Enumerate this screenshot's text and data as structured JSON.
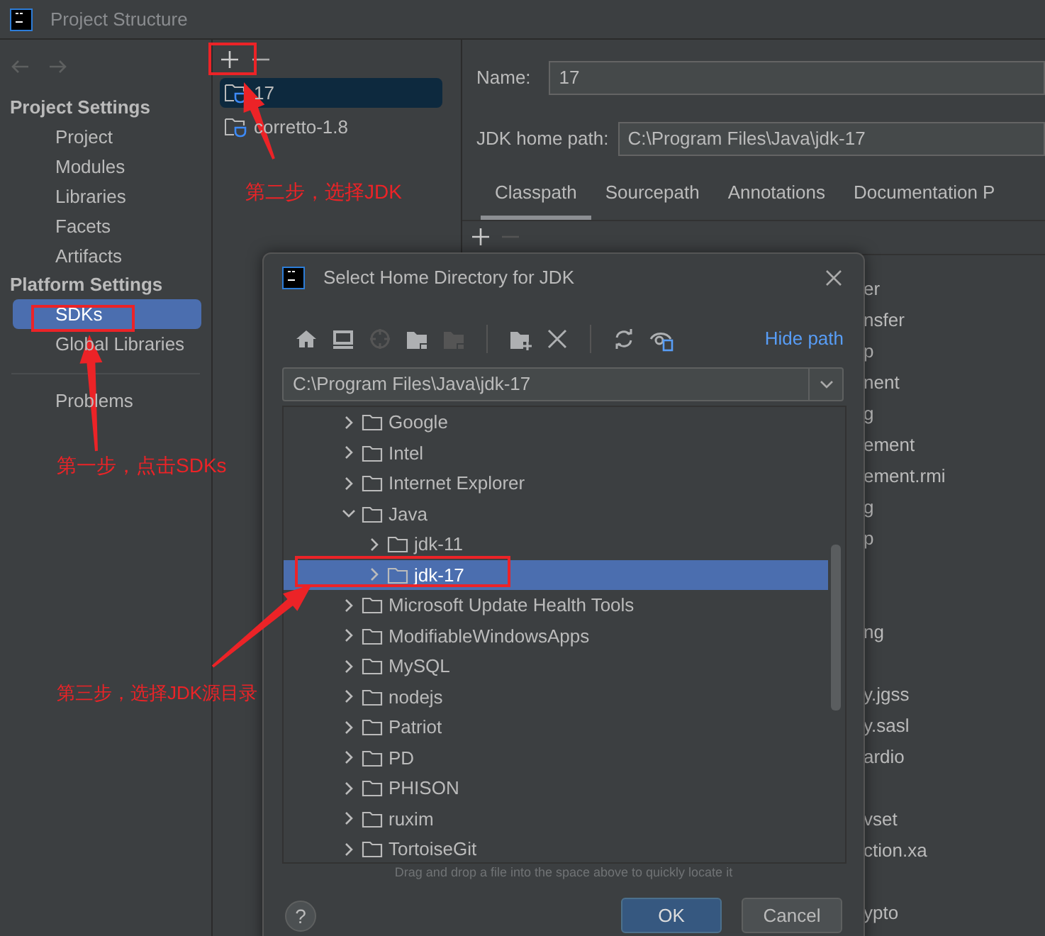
{
  "window": {
    "title": "Project Structure"
  },
  "sidebar": {
    "sections": [
      {
        "heading": "Project Settings",
        "items": [
          {
            "label": "Project",
            "selected": false
          },
          {
            "label": "Modules",
            "selected": false
          },
          {
            "label": "Libraries",
            "selected": false
          },
          {
            "label": "Facets",
            "selected": false
          },
          {
            "label": "Artifacts",
            "selected": false
          }
        ]
      },
      {
        "heading": "Platform Settings",
        "items": [
          {
            "label": "SDKs",
            "selected": true
          },
          {
            "label": "Global Libraries",
            "selected": false
          }
        ]
      }
    ],
    "footer_items": [
      {
        "label": "Problems",
        "selected": false
      }
    ]
  },
  "sdk_list": {
    "items": [
      {
        "label": "17",
        "selected": true
      },
      {
        "label": "corretto-1.8",
        "selected": false
      }
    ]
  },
  "details": {
    "name_label": "Name:",
    "name_value": "17",
    "home_label": "JDK home path:",
    "home_value": "C:\\Program Files\\Java\\jdk-17",
    "tabs": [
      {
        "label": "Classpath",
        "selected": true
      },
      {
        "label": "Sourcepath",
        "selected": false
      },
      {
        "label": "Annotations",
        "selected": false
      },
      {
        "label": "Documentation P",
        "selected": false
      }
    ],
    "rows": [
      {
        "text": "er"
      },
      {
        "text": "nsfer"
      },
      {
        "text": "p"
      },
      {
        "text": "nent"
      },
      {
        "text": "g"
      },
      {
        "text": "ement"
      },
      {
        "text": "ement.rmi"
      },
      {
        "text": "g"
      },
      {
        "text": "p",
        "kind": "text"
      },
      {
        "kind": "blank"
      },
      {
        "kind": "blank"
      },
      {
        "text": "ng"
      },
      {
        "kind": "blank"
      },
      {
        "text": "y.jgss"
      },
      {
        "text": "y.sasl"
      },
      {
        "text": "ardio"
      },
      {
        "kind": "blank"
      },
      {
        "text": "vset"
      },
      {
        "text": "ction.xa"
      },
      {
        "kind": "blank"
      },
      {
        "text": "ypto"
      }
    ]
  },
  "dialog": {
    "title": "Select Home Directory for JDK",
    "toolbar": [
      {
        "kind": "home",
        "disabled": false
      },
      {
        "kind": "desktop",
        "disabled": false
      },
      {
        "kind": "target",
        "disabled": true
      },
      {
        "kind": "folder",
        "disabled": false
      },
      {
        "kind": "folder",
        "disabled": true
      },
      {
        "kind": "separator"
      },
      {
        "kind": "new-folder",
        "disabled": false
      },
      {
        "kind": "delete",
        "disabled": false
      },
      {
        "kind": "separator"
      },
      {
        "kind": "refresh",
        "disabled": false
      },
      {
        "kind": "eye",
        "disabled": false
      }
    ],
    "hide_path": "Hide path",
    "path_value": "C:\\Program Files\\Java\\jdk-17",
    "tree": [
      {
        "label": "Google",
        "expanded": false,
        "selected": false
      },
      {
        "label": "Intel",
        "expanded": false,
        "selected": false
      },
      {
        "label": "Internet Explorer",
        "expanded": false,
        "selected": false
      },
      {
        "label": "Java",
        "expanded": true,
        "selected": false,
        "children": [
          {
            "label": "jdk-11",
            "expanded": false,
            "selected": false
          },
          {
            "label": "jdk-17",
            "expanded": false,
            "selected": true
          }
        ]
      },
      {
        "label": "Microsoft Update Health Tools",
        "expanded": false,
        "selected": false
      },
      {
        "label": "ModifiableWindowsApps",
        "expanded": false,
        "selected": false
      },
      {
        "label": "MySQL",
        "expanded": false,
        "selected": false
      },
      {
        "label": "nodejs",
        "expanded": false,
        "selected": false
      },
      {
        "label": "Patriot",
        "expanded": false,
        "selected": false
      },
      {
        "label": "PD",
        "expanded": false,
        "selected": false
      },
      {
        "label": "PHISON",
        "expanded": false,
        "selected": false
      },
      {
        "label": "ruxim",
        "expanded": false,
        "selected": false
      },
      {
        "label": "TortoiseGit",
        "expanded": false,
        "selected": false
      }
    ],
    "hint": "Drag and drop a file into the space above to quickly locate it",
    "help": "?",
    "buttons": [
      {
        "label": "OK",
        "kind": "primary"
      },
      {
        "label": "Cancel",
        "kind": "secondary"
      }
    ]
  },
  "annotations": [
    {
      "text": "第二步，选择JDK"
    },
    {
      "text": "第一步，点击SDKs"
    },
    {
      "text": "第三步，选择JDK源目录"
    }
  ]
}
